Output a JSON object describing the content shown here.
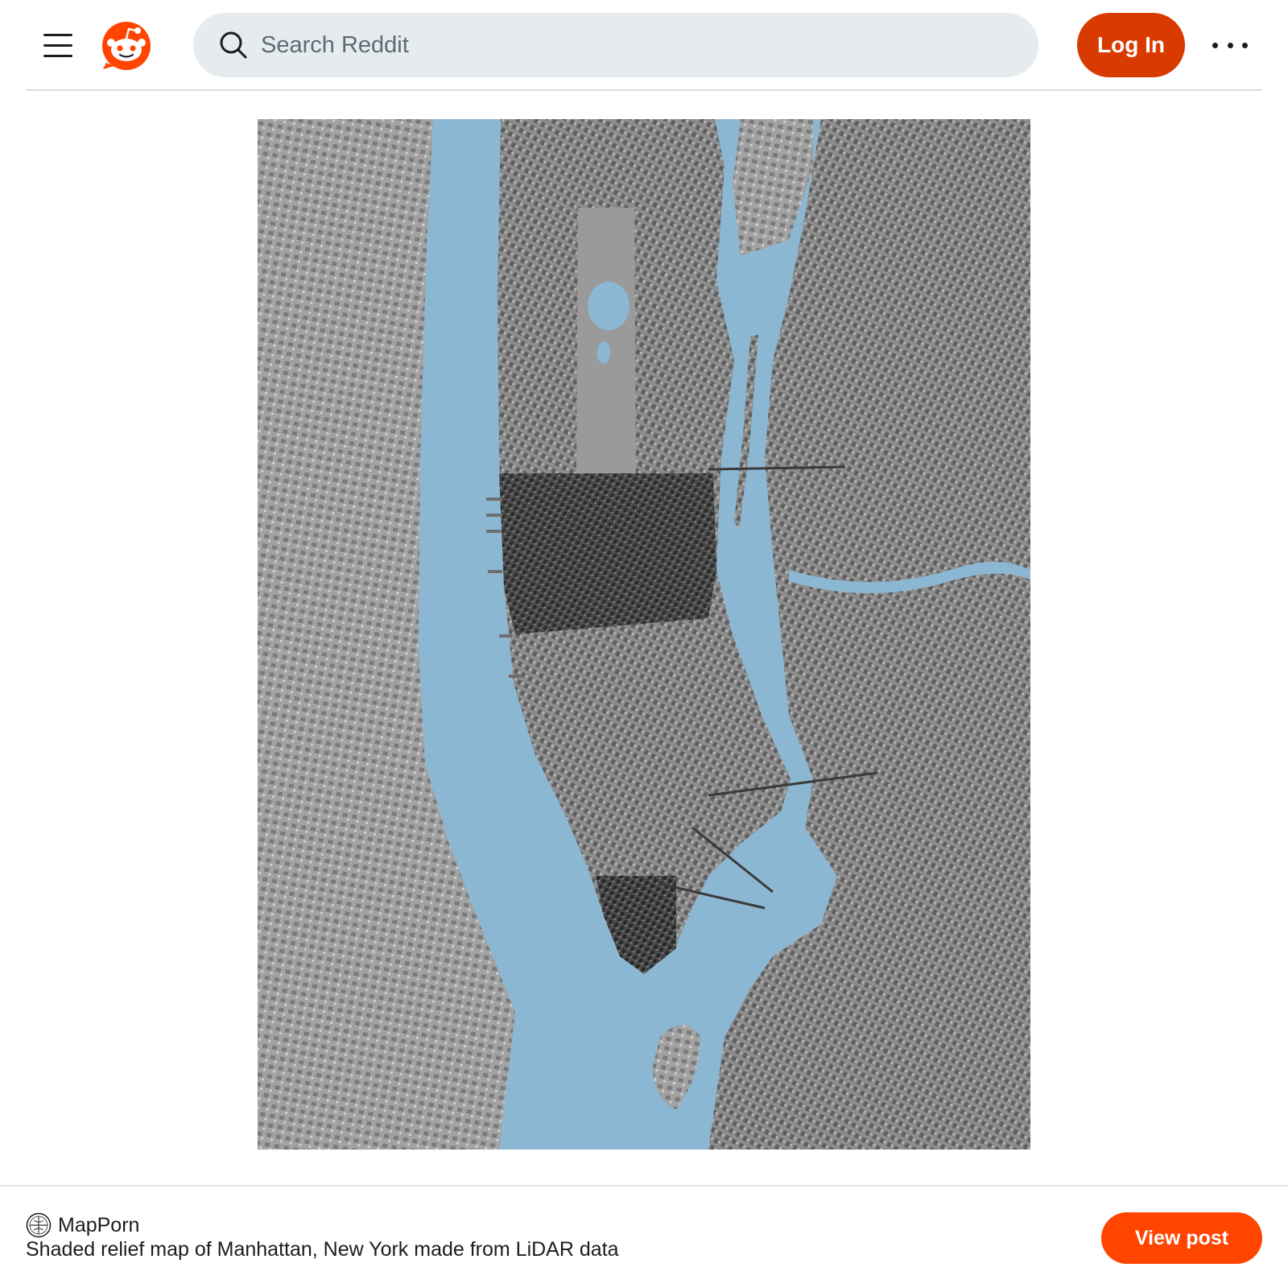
{
  "header": {
    "menu_icon": "hamburger-menu-icon",
    "logo_icon": "reddit-snoo-logo-icon",
    "search": {
      "placeholder": "Search Reddit",
      "value": "",
      "icon": "search-icon"
    },
    "login_label": "Log In",
    "more_icon": "more-options-icon"
  },
  "post": {
    "image_alt": "Shaded relief map of Manhattan, New York",
    "subreddit": "MapPorn",
    "subreddit_icon": "subreddit-avatar-icon",
    "title": "Shaded relief map of Manhattan, New York made from LiDAR data",
    "view_label": "View post"
  },
  "colors": {
    "brand_orange": "#ff4500",
    "login_orange": "#d93a00",
    "search_bg": "#e5ebee",
    "water": "#8cb7d3",
    "land": "#8a8a8a"
  }
}
